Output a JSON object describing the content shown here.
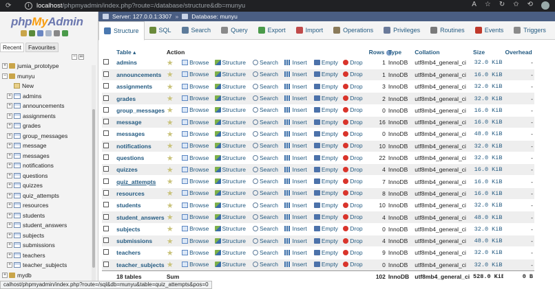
{
  "browser": {
    "url_host": "localhost",
    "url_path": "/phpmyadmin/index.php?route=/database/structure&db=munyu"
  },
  "status_bar_url": "calhost/phpmyadmin/index.php?route=/sql&db=munyu&table=quiz_attempts&pos=0",
  "sidebar": {
    "logo_php": "php",
    "logo_my": "My",
    "logo_admin": "Admin",
    "tabs": [
      "Recent",
      "Favourites"
    ],
    "tree": [
      {
        "label": "jumia_prototype",
        "kind": "db",
        "exp": "+"
      },
      {
        "label": "munyu",
        "kind": "db",
        "exp": "−"
      },
      {
        "label": "New",
        "kind": "new",
        "exp": ""
      },
      {
        "label": "admins",
        "kind": "table",
        "exp": "+"
      },
      {
        "label": "announcements",
        "kind": "table",
        "exp": "+"
      },
      {
        "label": "assignments",
        "kind": "table",
        "exp": "+"
      },
      {
        "label": "grades",
        "kind": "table",
        "exp": "+"
      },
      {
        "label": "group_messages",
        "kind": "table",
        "exp": "+"
      },
      {
        "label": "message",
        "kind": "table",
        "exp": "+"
      },
      {
        "label": "messages",
        "kind": "table",
        "exp": "+"
      },
      {
        "label": "notifications",
        "kind": "table",
        "exp": "+"
      },
      {
        "label": "questions",
        "kind": "table",
        "exp": "+"
      },
      {
        "label": "quizzes",
        "kind": "table",
        "exp": "+"
      },
      {
        "label": "quiz_attempts",
        "kind": "table",
        "exp": "+"
      },
      {
        "label": "resources",
        "kind": "table",
        "exp": "+"
      },
      {
        "label": "students",
        "kind": "table",
        "exp": "+"
      },
      {
        "label": "student_answers",
        "kind": "table",
        "exp": "+"
      },
      {
        "label": "subjects",
        "kind": "table",
        "exp": "+"
      },
      {
        "label": "submissions",
        "kind": "table",
        "exp": "+"
      },
      {
        "label": "teachers",
        "kind": "table",
        "exp": "+"
      },
      {
        "label": "teacher_subjects",
        "kind": "table",
        "exp": "+"
      },
      {
        "label": "mydb",
        "kind": "db",
        "exp": "+"
      }
    ]
  },
  "breadcrumb": {
    "server": "Server: 127.0.0.1:3307",
    "database": "Database: munyu"
  },
  "tabs": [
    {
      "label": "Structure",
      "color": "#4a78b0",
      "active": true
    },
    {
      "label": "SQL",
      "color": "#6a8a3a",
      "active": false
    },
    {
      "label": "Search",
      "color": "#5d7b9a",
      "active": false
    },
    {
      "label": "Query",
      "color": "#8a8a8a",
      "active": false
    },
    {
      "label": "Export",
      "color": "#4a9a4a",
      "active": false
    },
    {
      "label": "Import",
      "color": "#c04a4a",
      "active": false
    },
    {
      "label": "Operations",
      "color": "#8a7a5a",
      "active": false
    },
    {
      "label": "Privileges",
      "color": "#6a7a9a",
      "active": false
    },
    {
      "label": "Routines",
      "color": "#7a7a7a",
      "active": false
    },
    {
      "label": "Events",
      "color": "#c0392b",
      "active": false
    },
    {
      "label": "Triggers",
      "color": "#8a8a8a",
      "active": false
    }
  ],
  "table": {
    "headers": {
      "table": "Table",
      "action": "Action",
      "rows": "Rows",
      "type": "Type",
      "collation": "Collation",
      "size": "Size",
      "overhead": "Overhead"
    },
    "actions": [
      "Browse",
      "Structure",
      "Search",
      "Insert",
      "Empty",
      "Drop"
    ],
    "rows": [
      {
        "name": "admins",
        "rows": "1",
        "type": "InnoDB",
        "collation": "utf8mb4_general_ci",
        "size": "32.0 KiB",
        "overhead": "-"
      },
      {
        "name": "announcements",
        "rows": "1",
        "type": "InnoDB",
        "collation": "utf8mb4_general_ci",
        "size": "16.0 KiB",
        "overhead": "-"
      },
      {
        "name": "assignments",
        "rows": "3",
        "type": "InnoDB",
        "collation": "utf8mb4_general_ci",
        "size": "32.0 KiB",
        "overhead": "-"
      },
      {
        "name": "grades",
        "rows": "2",
        "type": "InnoDB",
        "collation": "utf8mb4_general_ci",
        "size": "32.0 KiB",
        "overhead": "-"
      },
      {
        "name": "group_messages",
        "rows": "0",
        "type": "InnoDB",
        "collation": "utf8mb4_general_ci",
        "size": "16.0 KiB",
        "overhead": "-"
      },
      {
        "name": "message",
        "rows": "16",
        "type": "InnoDB",
        "collation": "utf8mb4_general_ci",
        "size": "16.0 KiB",
        "overhead": "-"
      },
      {
        "name": "messages",
        "rows": "0",
        "type": "InnoDB",
        "collation": "utf8mb4_general_ci",
        "size": "48.0 KiB",
        "overhead": "-"
      },
      {
        "name": "notifications",
        "rows": "10",
        "type": "InnoDB",
        "collation": "utf8mb4_general_ci",
        "size": "32.0 KiB",
        "overhead": "-"
      },
      {
        "name": "questions",
        "rows": "22",
        "type": "InnoDB",
        "collation": "utf8mb4_general_ci",
        "size": "32.0 KiB",
        "overhead": "-"
      },
      {
        "name": "quizzes",
        "rows": "4",
        "type": "InnoDB",
        "collation": "utf8mb4_general_ci",
        "size": "16.0 KiB",
        "overhead": "-"
      },
      {
        "name": "quiz_attempts",
        "rows": "7",
        "type": "InnoDB",
        "collation": "utf8mb4_general_ci",
        "size": "16.0 KiB",
        "overhead": "-",
        "hover": true
      },
      {
        "name": "resources",
        "rows": "8",
        "type": "InnoDB",
        "collation": "utf8mb4_general_ci",
        "size": "16.0 KiB",
        "overhead": "-"
      },
      {
        "name": "students",
        "rows": "10",
        "type": "InnoDB",
        "collation": "utf8mb4_general_ci",
        "size": "32.0 KiB",
        "overhead": "-"
      },
      {
        "name": "student_answers",
        "rows": "4",
        "type": "InnoDB",
        "collation": "utf8mb4_general_ci",
        "size": "48.0 KiB",
        "overhead": "-"
      },
      {
        "name": "subjects",
        "rows": "0",
        "type": "InnoDB",
        "collation": "utf8mb4_general_ci",
        "size": "32.0 KiB",
        "overhead": "-"
      },
      {
        "name": "submissions",
        "rows": "4",
        "type": "InnoDB",
        "collation": "utf8mb4_general_ci",
        "size": "48.0 KiB",
        "overhead": "-"
      },
      {
        "name": "teachers",
        "rows": "9",
        "type": "InnoDB",
        "collation": "utf8mb4_general_ci",
        "size": "32.0 KiB",
        "overhead": "-"
      },
      {
        "name": "teacher_subjects",
        "rows": "0",
        "type": "InnoDB",
        "collation": "utf8mb4_general_ci",
        "size": "32.0 KiB",
        "overhead": "-"
      }
    ],
    "footer": {
      "count": "18 tables",
      "sum": "Sum",
      "rows": "102",
      "type": "InnoDB",
      "collation": "utf8mb4_general_ci",
      "size": "528.0 KiB",
      "overhead": "0 B"
    }
  }
}
